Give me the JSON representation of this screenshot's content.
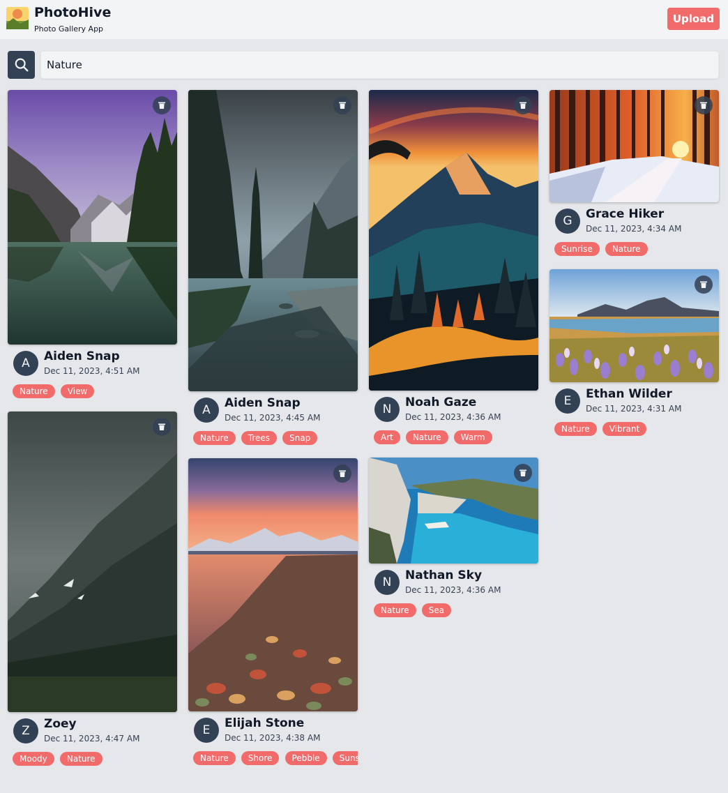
{
  "app": {
    "title": "PhotoHive",
    "subtitle": "Photo Gallery App",
    "upload_label": "Upload"
  },
  "search": {
    "value": "Nature",
    "icon": "search-icon"
  },
  "posts": [
    {
      "author": "Aiden Snap",
      "initial": "A",
      "date": "Dec 11, 2023, 4:51 AM",
      "tags": [
        "Nature",
        "View"
      ],
      "scene": "lake-mountains"
    },
    {
      "author": "Zoey",
      "initial": "Z",
      "date": "Dec 11, 2023, 4:47 AM",
      "tags": [
        "Moody",
        "Nature"
      ],
      "scene": "moody-mountain"
    },
    {
      "author": "Aiden Snap",
      "initial": "A",
      "date": "Dec 11, 2023, 4:45 AM",
      "tags": [
        "Nature",
        "Trees",
        "Snap"
      ],
      "scene": "forest-river"
    },
    {
      "author": "Elijah Stone",
      "initial": "E",
      "date": "Dec 11, 2023, 4:38 AM",
      "tags": [
        "Nature",
        "Shore",
        "Pebble",
        "Sunset"
      ],
      "scene": "pebble-sunset"
    },
    {
      "author": "Noah Gaze",
      "initial": "N",
      "date": "Dec 11, 2023, 4:36 AM",
      "tags": [
        "Art",
        "Nature",
        "Warm"
      ],
      "scene": "art-mountains"
    },
    {
      "author": "Nathan Sky",
      "initial": "N",
      "date": "Dec 11, 2023, 4:36 AM",
      "tags": [
        "Nature",
        "Sea"
      ],
      "scene": "sea-cove"
    },
    {
      "author": "Grace Hiker",
      "initial": "G",
      "date": "Dec 11, 2023, 4:34 AM",
      "tags": [
        "Sunrise",
        "Nature"
      ],
      "scene": "snow-forest-sunrise"
    },
    {
      "author": "Ethan Wilder",
      "initial": "E",
      "date": "Dec 11, 2023, 4:31 AM",
      "tags": [
        "Nature",
        "Vibrant"
      ],
      "scene": "lupine-field"
    }
  ],
  "icons": {
    "delete": "trash-icon",
    "logo": "photohive-logo"
  },
  "colors": {
    "accent": "#f26b6b",
    "dark": "#334155",
    "background": "#e5e7eb",
    "header": "#f3f4f6"
  }
}
